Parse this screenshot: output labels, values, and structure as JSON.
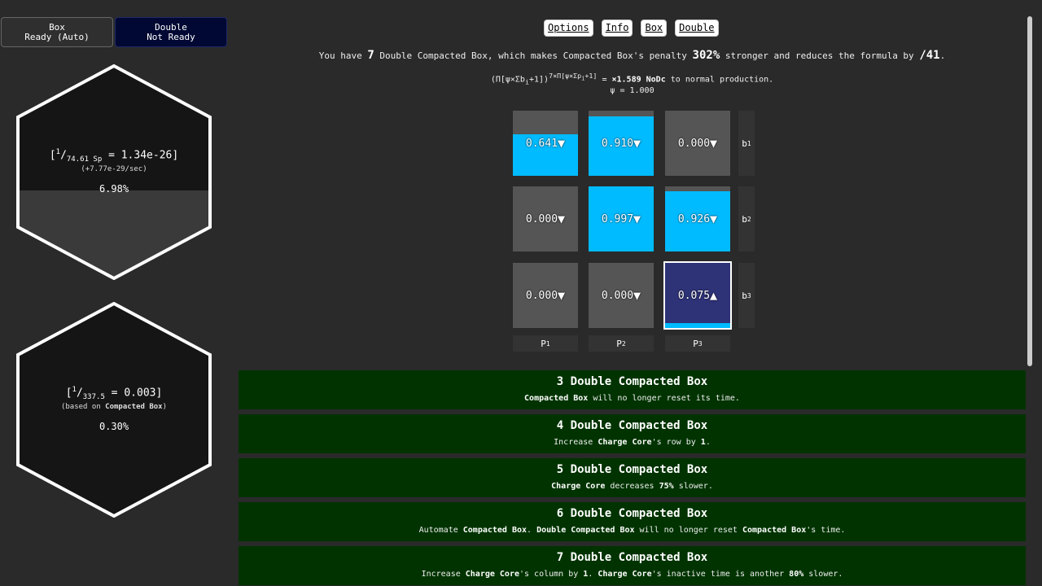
{
  "top_buttons": {
    "box": {
      "line1": "Box",
      "line2": "Ready (Auto)"
    },
    "double": {
      "line1": "Double",
      "line2": "Not Ready"
    }
  },
  "hex1": {
    "formula_num": "1",
    "formula_den": "74.61 Sp",
    "formula_val": " = 1.34e-26]",
    "rate": "(+7.77e-29/sec)",
    "percent": "6.98%",
    "fill_fraction": 0.0698
  },
  "hex2": {
    "formula_num": "1",
    "formula_den": "337.5",
    "formula_val": " = 0.003]",
    "based_pre": "(based on ",
    "based_b": "Compacted Box",
    "based_post": ")",
    "percent": "0.30%",
    "fill_fraction": 0.003
  },
  "nav": [
    "Options",
    "Info",
    "Box",
    "Double"
  ],
  "info": {
    "p1": "You have ",
    "count": "7",
    "p2": " Double Compacted Box, which makes Compacted Box's penalty ",
    "penalty": "302%",
    "p3": " stronger and reduces the formula by ",
    "reduce": "/41",
    "p4": ".",
    "formula_pre": "(Π[ψ×Σb",
    "formula_sub1": "i",
    "formula_mid": "+1])",
    "formula_sup": "7×Π[ψ×Σp",
    "formula_sup_sub": "i",
    "formula_sup_end": "+1]",
    "formula_eq": " = ",
    "multiplier": "×1.589 NoDc",
    "formula_end": " to normal production.",
    "psi": "ψ = 1.000"
  },
  "grid": {
    "rows": [
      [
        {
          "v": "0.641",
          "a": "▼",
          "f": 0.641
        },
        {
          "v": "0.910",
          "a": "▼",
          "f": 0.91
        },
        {
          "v": "0.000",
          "a": "▼",
          "f": 0
        }
      ],
      [
        {
          "v": "0.000",
          "a": "▼",
          "f": 0
        },
        {
          "v": "0.997",
          "a": "▼",
          "f": 0.997
        },
        {
          "v": "0.926",
          "a": "▼",
          "f": 0.926
        }
      ],
      [
        {
          "v": "0.000",
          "a": "▼",
          "f": 0
        },
        {
          "v": "0.000",
          "a": "▼",
          "f": 0
        },
        {
          "v": "0.075",
          "a": "▲",
          "f": 0.075
        }
      ]
    ],
    "row_labels": [
      {
        "b": "b",
        "s": "1"
      },
      {
        "b": "b",
        "s": "2"
      },
      {
        "b": "b",
        "s": "3"
      }
    ],
    "col_labels": [
      {
        "b": "P",
        "s": "1"
      },
      {
        "b": "P",
        "s": "2"
      },
      {
        "b": "P",
        "s": "3"
      }
    ]
  },
  "milestones": [
    {
      "title": "3 Double Compacted Box",
      "d": [
        [
          "Compacted Box",
          true
        ],
        [
          " will no longer reset its time.",
          false
        ]
      ]
    },
    {
      "title": "4 Double Compacted Box",
      "d": [
        [
          "Increase ",
          false
        ],
        [
          "Charge Core",
          true
        ],
        [
          "'s row by ",
          false
        ],
        [
          "1",
          true
        ],
        [
          ".",
          false
        ]
      ]
    },
    {
      "title": "5 Double Compacted Box",
      "d": [
        [
          "Charge Core",
          true
        ],
        [
          " decreases ",
          false
        ],
        [
          "75%",
          true
        ],
        [
          " slower.",
          false
        ]
      ]
    },
    {
      "title": "6 Double Compacted Box",
      "d": [
        [
          "Automate ",
          false
        ],
        [
          "Compacted Box",
          true
        ],
        [
          ". ",
          false
        ],
        [
          "Double Compacted Box",
          true
        ],
        [
          " will no longer reset ",
          false
        ],
        [
          "Compacted Box",
          true
        ],
        [
          "'s time.",
          false
        ]
      ]
    },
    {
      "title": "7 Double Compacted Box",
      "d": [
        [
          "Increase ",
          false
        ],
        [
          "Charge Core",
          true
        ],
        [
          "'s column by ",
          false
        ],
        [
          "1",
          true
        ],
        [
          ". ",
          false
        ],
        [
          "Charge Core",
          true
        ],
        [
          "'s inactive time is another ",
          false
        ],
        [
          "80%",
          true
        ],
        [
          " slower.",
          false
        ]
      ]
    }
  ]
}
